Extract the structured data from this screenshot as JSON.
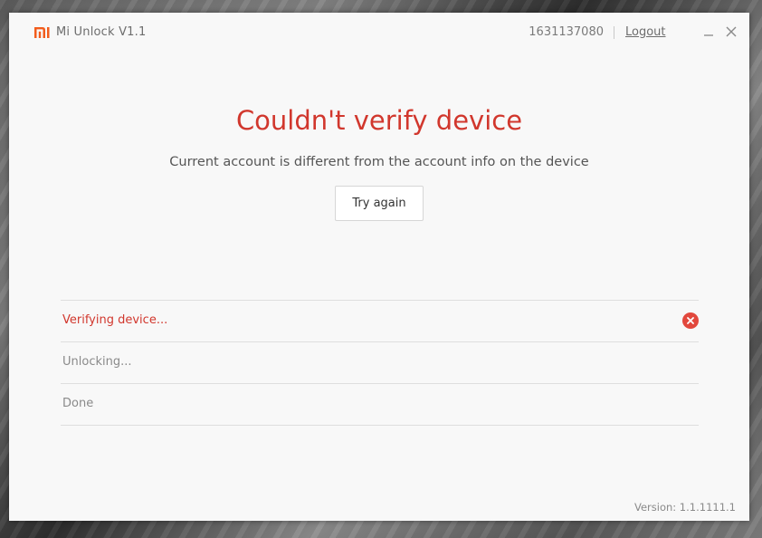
{
  "app": {
    "title": "Mi Unlock  V1.1",
    "logo_icon": "mi-logo-icon",
    "brand_color": "#f25c1c"
  },
  "header": {
    "account_id": "1631137080",
    "logout_label": "Logout",
    "minimize_icon": "minimize-icon",
    "close_icon": "close-icon"
  },
  "main": {
    "title": "Couldn't verify device",
    "subtitle": "Current account is different from the account info on the device",
    "try_again_label": "Try again",
    "error_color": "#d1372d"
  },
  "steps": [
    {
      "label": "Verifying device...",
      "state": "error",
      "icon": "error-x-circle-icon"
    },
    {
      "label": "Unlocking...",
      "state": "pending"
    },
    {
      "label": "Done",
      "state": "pending"
    }
  ],
  "footer": {
    "version": "Version: 1.1.1111.1"
  }
}
